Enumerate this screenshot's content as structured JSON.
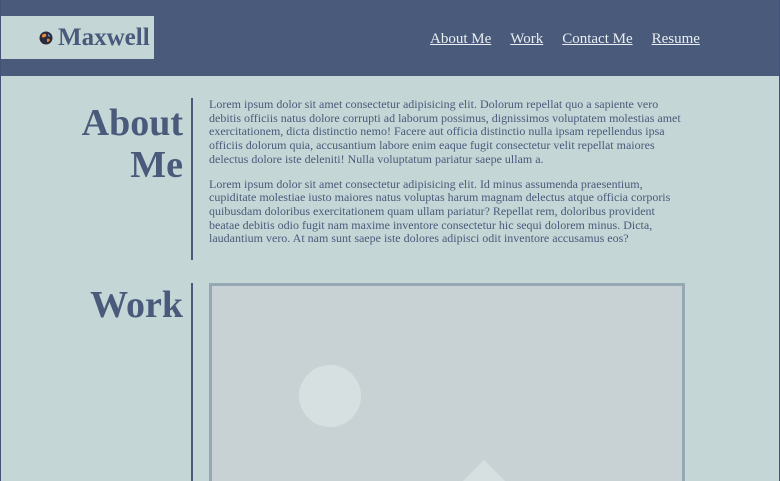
{
  "header": {
    "brand_name": "Maxwell",
    "brand_icon": "globe-icon",
    "nav": [
      {
        "label": "About Me"
      },
      {
        "label": "Work"
      },
      {
        "label": "Contact Me"
      },
      {
        "label": "Resume"
      }
    ]
  },
  "about": {
    "title": "About Me",
    "paragraphs": [
      "Lorem ipsum dolor sit amet consectetur adipisicing elit. Dolorum repellat quo a sapiente vero debitis officiis natus dolore corrupti ad laborum possimus, dignissimos voluptatem molestias amet exercitationem, dicta distinctio nemo! Facere aut officia distinctio nulla ipsam repellendus ipsa officiis dolorum quia, accusantium labore enim eaque fugit consectetur velit repellat maiores delectus dolore iste deleniti! Nulla voluptatum pariatur saepe ullam a.",
      "Lorem ipsum dolor sit amet consectetur adipisicing elit. Id minus assumenda praesentium, cupiditate molestiae iusto maiores natus voluptas harum magnam delectus atque officia corporis quibusdam doloribus exercitationem quam ullam pariatur? Repellat rem, doloribus provident beatae debitis odio fugit nam maxime inventore consectetur hic sequi dolorem minus. Dicta, laudantium vero. At nam sunt saepe iste dolores adipisci odit inventore accusamus eos?"
    ]
  },
  "work": {
    "title": "Work",
    "image_icon": "image-placeholder-icon"
  },
  "colors": {
    "header_bg": "#4a5a7b",
    "page_bg": "#c4d7d6",
    "accent": "#4a5a7b",
    "nav_text": "#e8eef1"
  }
}
